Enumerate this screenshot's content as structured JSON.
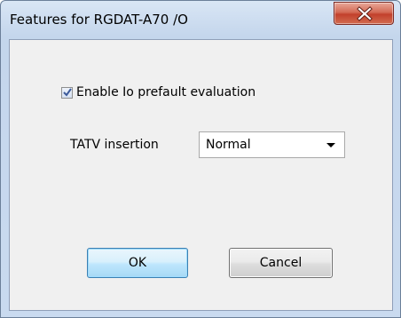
{
  "window": {
    "title": "Features for RGDAT-A70 /O"
  },
  "options": {
    "prefault_label": "Enable Io prefault evaluation",
    "prefault_checked": true,
    "tatv_label": "TATV insertion",
    "tatv_value": "Normal"
  },
  "buttons": {
    "ok_label": "OK",
    "cancel_label": "Cancel"
  },
  "icons": {
    "close": "close-icon",
    "checkmark": "checkmark-icon",
    "dropdown": "chevron-down-icon"
  },
  "colors": {
    "close_button": "#c8462f",
    "ok_border": "#3c7fb1",
    "dialog_face": "#f0f0f0",
    "checkmark": "#3c5a9a"
  }
}
